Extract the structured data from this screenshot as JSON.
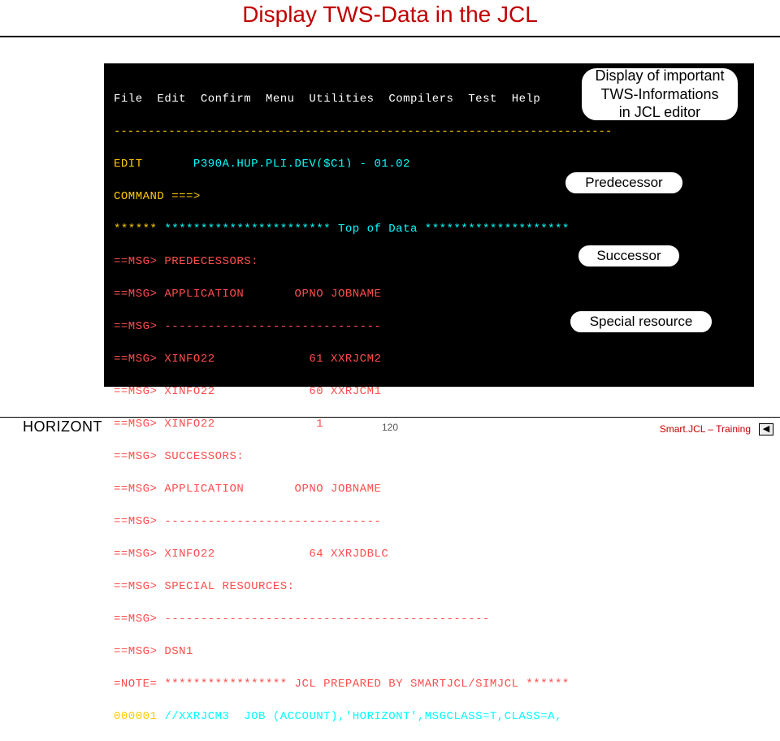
{
  "slide": {
    "title": "Display TWS-Data in the JCL"
  },
  "terminal": {
    "menu": {
      "file": "File",
      "edit": "Edit",
      "confirm": "Confirm",
      "menu": "Menu",
      "utilities": "Utilities",
      "compilers": "Compilers",
      "test": "Test",
      "help": "Help"
    },
    "separator": "-------------------------------------------------------------------------",
    "edit_line_label": "EDIT",
    "dataset": "P390A.HUP.PLI.DEV($C1) - 01.02",
    "command_prompt": "COMMAND ===>",
    "top_marker_left": "******",
    "top_marker_mid": "***********************",
    "top_marker_text": "Top of Data",
    "top_marker_right": "********************",
    "lines": [
      {
        "prefix": "==MSG>",
        "text": "PREDECESSORS:"
      },
      {
        "prefix": "==MSG>",
        "text": "APPLICATION       OPNO JOBNAME"
      },
      {
        "prefix": "==MSG>",
        "text": "------------------------------"
      },
      {
        "prefix": "==MSG>",
        "text": "XINFO22             61 XXRJCM2"
      },
      {
        "prefix": "==MSG>",
        "text": "XINFO22             60 XXRJCM1"
      },
      {
        "prefix": "==MSG>",
        "text": "XINFO22              1"
      },
      {
        "prefix": "==MSG>",
        "text": "SUCCESSORS:"
      },
      {
        "prefix": "==MSG>",
        "text": "APPLICATION       OPNO JOBNAME"
      },
      {
        "prefix": "==MSG>",
        "text": "------------------------------"
      },
      {
        "prefix": "==MSG>",
        "text": "XINFO22             64 XXRJDBLC"
      },
      {
        "prefix": "==MSG>",
        "text": "SPECIAL RESOURCES:"
      },
      {
        "prefix": "==MSG>",
        "text": "---------------------------------------------"
      },
      {
        "prefix": "==MSG>",
        "text": "DSN1"
      }
    ],
    "note_prefix": "=NOTE=",
    "note_text": "***************** JCL PREPARED BY SMARTJCL/SIMJCL ******",
    "seq_prefix": "000001",
    "jcl_line": "//XXRJCM3  JOB (ACCOUNT),'HORIZONT',MSGCLASS=T,CLASS=A,"
  },
  "callouts": {
    "top": "Display of important\nTWS-Informations\nin JCL editor",
    "predecessor": "Predecessor",
    "successor": "Successor",
    "special": "Special resource"
  },
  "footer": {
    "left": "HORIZONT",
    "page": "120",
    "right": "Smart.JCL – Training",
    "prev_arrow": "◀"
  }
}
